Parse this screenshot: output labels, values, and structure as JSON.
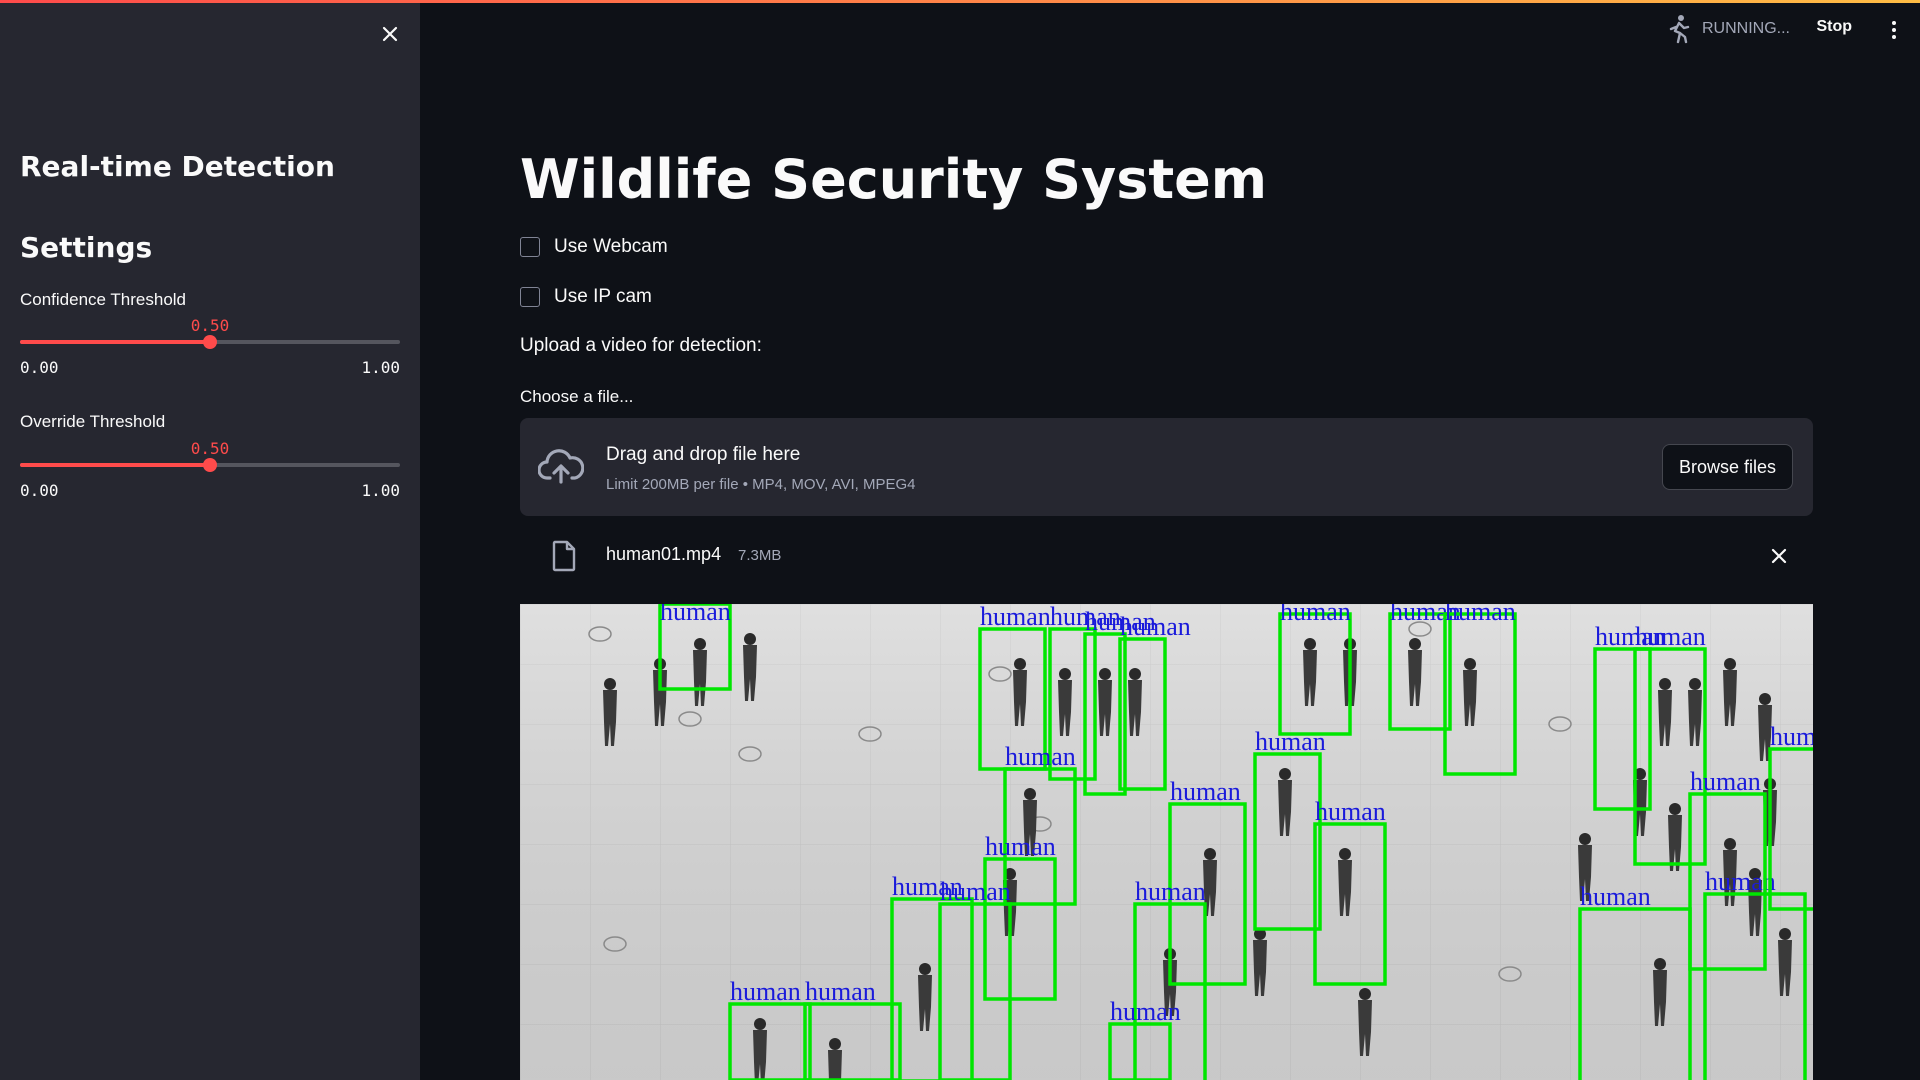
{
  "sidebar": {
    "close_icon": "close-icon",
    "heading": "Real-time Detection",
    "settings_heading": "Settings",
    "sliders": [
      {
        "label": "Confidence Threshold",
        "value": "0.50",
        "value_num": 0.5,
        "min": "0.00",
        "max": "1.00"
      },
      {
        "label": "Override Threshold",
        "value": "0.50",
        "value_num": 0.5,
        "min": "0.00",
        "max": "1.00"
      }
    ]
  },
  "topbar": {
    "status": "RUNNING...",
    "status_icon": "running-man-icon",
    "stop_label": "Stop",
    "menu_icon": "kebab-menu-icon"
  },
  "main": {
    "title": "Wildlife Security System",
    "checkboxes": [
      {
        "label": "Use Webcam",
        "checked": false
      },
      {
        "label": "Use IP cam",
        "checked": false
      }
    ],
    "upload_label": "Upload a video for detection:",
    "uploader": {
      "label": "Choose a file...",
      "drop_text": "Drag and drop file here",
      "limit_text": "Limit 200MB per file • MP4, MOV, AVI, MPEG4",
      "browse_label": "Browse files",
      "icon": "cloud-upload-icon"
    },
    "file": {
      "name": "human01.mp4",
      "size": "7.3MB",
      "icon": "file-icon",
      "remove_icon": "close-icon"
    },
    "video": {
      "detection_label": "human"
    }
  },
  "colors": {
    "accent": "#ff4b4b",
    "background": "#0e1117",
    "sidebar": "#262730",
    "box": "#00e600",
    "label": "#1a1adb"
  }
}
